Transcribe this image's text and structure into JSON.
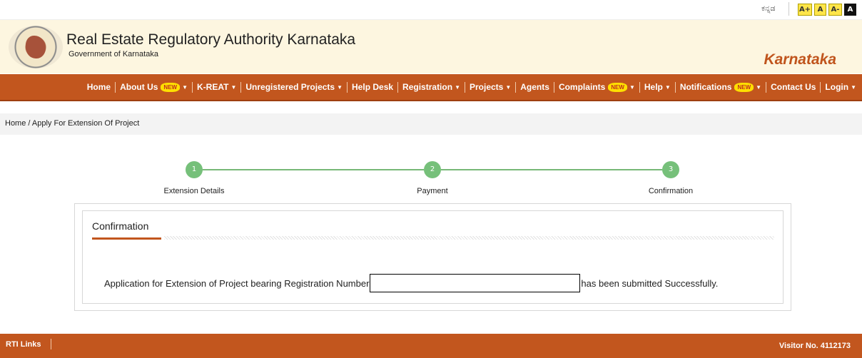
{
  "topbar": {
    "language": "ಕನ್ನಡ",
    "font_sizes": [
      "A+",
      "A",
      "A-",
      "A"
    ]
  },
  "header": {
    "title": "Real Estate Regulatory Authority Karnataka",
    "subtitle": "Government of Karnataka",
    "state": "Karnataka"
  },
  "nav": {
    "items": [
      {
        "label": "Home",
        "dropdown": false,
        "new": false
      },
      {
        "label": "About Us",
        "dropdown": true,
        "new": true
      },
      {
        "label": "K-REAT",
        "dropdown": true,
        "new": false
      },
      {
        "label": "Unregistered Projects",
        "dropdown": true,
        "new": false
      },
      {
        "label": "Help Desk",
        "dropdown": false,
        "new": false
      },
      {
        "label": "Registration",
        "dropdown": true,
        "new": false
      },
      {
        "label": "Projects",
        "dropdown": true,
        "new": false
      },
      {
        "label": "Agents",
        "dropdown": false,
        "new": false
      },
      {
        "label": "Complaints",
        "dropdown": true,
        "new": true
      },
      {
        "label": "Help",
        "dropdown": true,
        "new": false
      },
      {
        "label": "Notifications",
        "dropdown": true,
        "new": true
      },
      {
        "label": "Contact Us",
        "dropdown": false,
        "new": false
      },
      {
        "label": "Login",
        "dropdown": true,
        "new": false
      }
    ],
    "new_badge": "NEW"
  },
  "breadcrumb": "Home / Apply For Extension Of Project",
  "stepper": {
    "steps": [
      {
        "number": "1",
        "label": "Extension Details"
      },
      {
        "number": "2",
        "label": "Payment"
      },
      {
        "number": "3",
        "label": "Confirmation"
      }
    ]
  },
  "panel": {
    "title": "Confirmation",
    "message_before": "Application for Extension of Project bearing Registration Number",
    "message_after": "has been submitted Successfully."
  },
  "footer": {
    "rti": "RTI Links",
    "visitor": "Visitor No. 4112173"
  },
  "colors": {
    "brand_orange": "#c2561e",
    "header_bg": "#fdf6e0",
    "step_green": "#76c07a",
    "font_button_yellow": "#ffe54a"
  }
}
